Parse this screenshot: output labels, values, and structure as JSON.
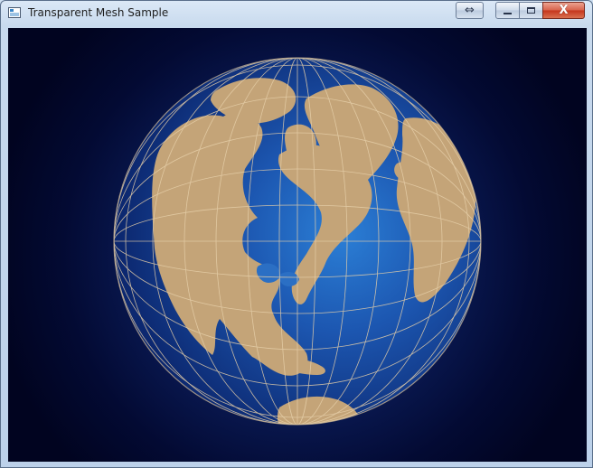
{
  "window": {
    "title": "Transparent Mesh Sample",
    "icon": "application-window-icon"
  },
  "titlebar_buttons": {
    "extra": "resize-arrows-icon",
    "minimize": "minimize-icon",
    "maximize": "maximize-icon",
    "close": "close-icon",
    "close_glyph": "X"
  },
  "colors": {
    "land": "#c4a478",
    "grid": "#e6cfa9",
    "ocean_light": "#2b73c9",
    "ocean_dark": "#0c2870",
    "background": "#010420",
    "close_button": "#c5341c"
  }
}
